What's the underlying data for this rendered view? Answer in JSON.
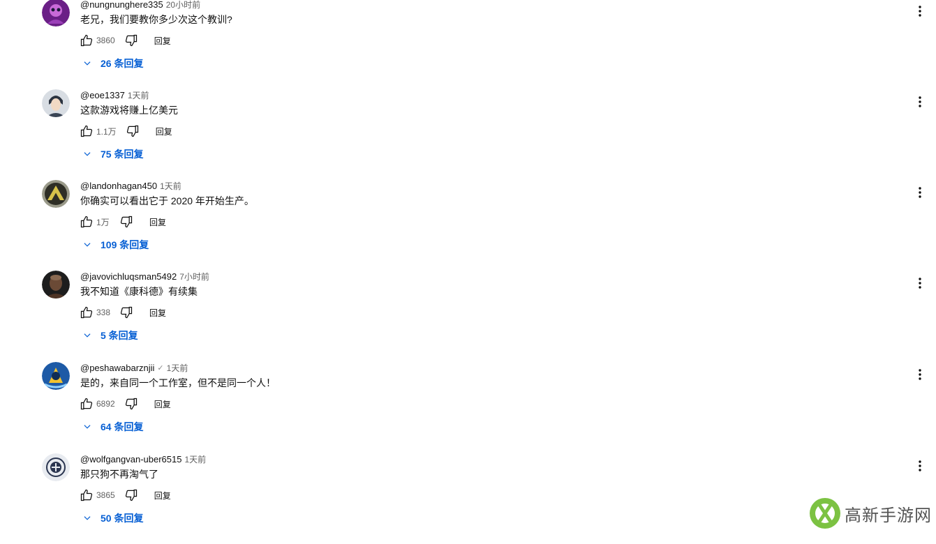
{
  "comments": [
    {
      "author": "@nungnunghere335",
      "verified": "",
      "time": "20小时前",
      "text": "老兄，我们要教你多少次这个教训?",
      "likes": "3860",
      "reply": "回复",
      "replies": "26 条回复",
      "avatar_color": "#7b2d8e"
    },
    {
      "author": "@eoe1337",
      "verified": "",
      "time": "1天前",
      "text": "这款游戏将赚上亿美元",
      "likes": "1.1万",
      "reply": "回复",
      "replies": "75 条回复",
      "avatar_color": "#4a5560"
    },
    {
      "author": "@landonhagan450",
      "verified": "",
      "time": "1天前",
      "text": "你确实可以看出它于 2020 年开始生产。",
      "likes": "1万",
      "reply": "回复",
      "replies": "109 条回复",
      "avatar_color": "#3a3a2a"
    },
    {
      "author": "@javovichluqsman5492",
      "verified": "",
      "time": "7小时前",
      "text": "我不知道《康科德》有续集",
      "likes": "338",
      "reply": "回复",
      "replies": "5 条回复",
      "avatar_color": "#3b2a22"
    },
    {
      "author": "@peshawabarznjii",
      "verified": "✓",
      "time": "1天前",
      "text": "是的，来自同一个工作室，但不是同一个人！",
      "likes": "6892",
      "reply": "回复",
      "replies": "64 条回复",
      "avatar_color": "#1e5fa8"
    },
    {
      "author": "@wolfgangvan-uber6515",
      "verified": "",
      "time": "1天前",
      "text": "那只狗不再淘气了",
      "likes": "3865",
      "reply": "回复",
      "replies": "50 条回复",
      "avatar_color": "#dfe3ea"
    }
  ],
  "watermark": {
    "text": "高新手游网"
  },
  "colors": {
    "link": "#065fd4",
    "meta": "#606060",
    "text": "#0f0f0f"
  }
}
